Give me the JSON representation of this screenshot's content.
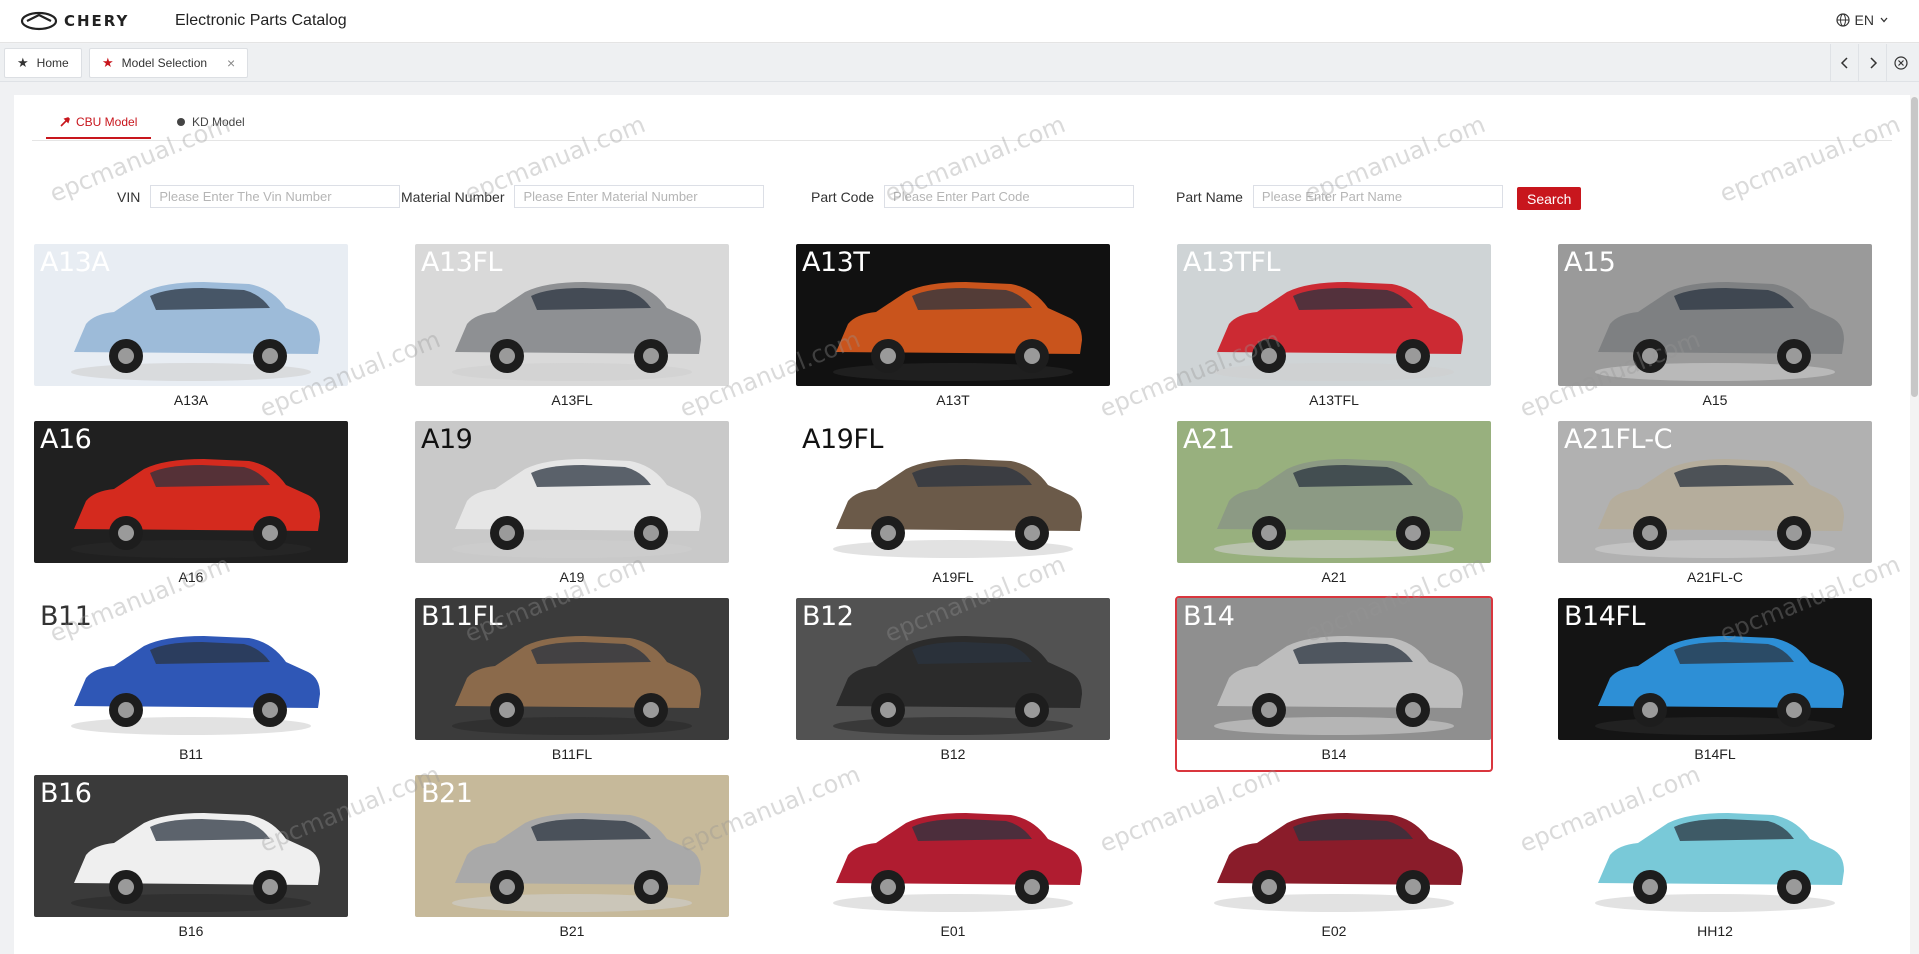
{
  "header": {
    "logo_text": "CHERY",
    "app_title": "Electronic Parts Catalog",
    "language": "EN"
  },
  "tabs": [
    {
      "label": "Home",
      "icon": "star-icon"
    },
    {
      "label": "Model Selection",
      "icon": "star-icon",
      "closable": true
    }
  ],
  "model_tabs": [
    {
      "label": "CBU Model",
      "active": true
    },
    {
      "label": "KD Model",
      "active": false
    }
  ],
  "search": {
    "vin_label": "VIN",
    "vin_placeholder": "Please Enter The Vin Number",
    "material_label": "Material Number",
    "material_placeholder": "Please Enter Material Number",
    "part_code_label": "Part Code",
    "part_code_placeholder": "Please Enter Part Code",
    "part_name_label": "Part Name",
    "part_name_placeholder": "Please Enter Part Name",
    "search_button": "Search"
  },
  "watermark_text": "epcmanual.com",
  "colors": {
    "accent": "#c8161d",
    "selected_border": "#d9363e"
  },
  "models": [
    {
      "code": "A13A",
      "overlay": "A13A",
      "bg": "#e8edf3",
      "car": "#9dbbd9",
      "overlay_color": "#ffffff",
      "dark": false
    },
    {
      "code": "A13FL",
      "overlay": "A13FL",
      "bg": "#d9d9d9",
      "car": "#8e9093",
      "overlay_color": "#ffffff",
      "dark": false
    },
    {
      "code": "A13T",
      "overlay": "A13T",
      "bg": "#111111",
      "car": "#c9541c",
      "overlay_color": "#ffffff",
      "dark": true
    },
    {
      "code": "A13TFL",
      "overlay": "A13TFL",
      "bg": "#cfd4d6",
      "car": "#cc2a33",
      "overlay_color": "#ffffff",
      "dark": false
    },
    {
      "code": "A15",
      "overlay": "A15",
      "bg": "#9a9a9a",
      "car": "#7e8082",
      "overlay_color": "#ffffff",
      "dark": false
    },
    {
      "code": "A16",
      "overlay": "A16",
      "bg": "#202020",
      "car": "#d42a1e",
      "overlay_color": "#ffffff",
      "dark": true
    },
    {
      "code": "A19",
      "overlay": "A19",
      "bg": "#c9c9c9",
      "car": "#e6e6e6",
      "overlay_color": "#111111",
      "dark": false
    },
    {
      "code": "A19FL",
      "overlay": "A19FL",
      "bg": "#ffffff",
      "car": "#6b5a49",
      "overlay_color": "#111111",
      "dark": false
    },
    {
      "code": "A21",
      "overlay": "A21",
      "bg": "#98b07e",
      "car": "#8c9a84",
      "overlay_color": "#ffffff",
      "dark": false
    },
    {
      "code": "A21FL-C",
      "overlay": "A21FL-C",
      "bg": "#b1b1b1",
      "car": "#b5ad9c",
      "overlay_color": "#ffffff",
      "dark": false
    },
    {
      "code": "B11",
      "overlay": "B11",
      "bg": "#ffffff",
      "car": "#2f57b6",
      "overlay_color": "#333333",
      "dark": false
    },
    {
      "code": "B11FL",
      "overlay": "B11FL",
      "bg": "#3b3b3b",
      "car": "#8b6a4b",
      "overlay_color": "#ffffff",
      "dark": true
    },
    {
      "code": "B12",
      "overlay": "B12",
      "bg": "#525252",
      "car": "#2b2b2b",
      "overlay_color": "#ffffff",
      "dark": true
    },
    {
      "code": "B14",
      "overlay": "B14",
      "bg": "#8f8f8f",
      "car": "#bdbdbd",
      "overlay_color": "#ffffff",
      "dark": false,
      "selected": true
    },
    {
      "code": "B14FL",
      "overlay": "B14FL",
      "bg": "#141414",
      "car": "#2d8fd6",
      "overlay_color": "#ffffff",
      "dark": true
    },
    {
      "code": "B16",
      "overlay": "B16",
      "bg": "#3a3a3a",
      "car": "#efefef",
      "overlay_color": "#ffffff",
      "dark": true
    },
    {
      "code": "B21",
      "overlay": "B21",
      "bg": "#c6b99a",
      "car": "#a9a9a9",
      "overlay_color": "#ffffff",
      "dark": false
    },
    {
      "code": "E01",
      "overlay": "",
      "bg": "#ffffff",
      "car": "#b01c30",
      "overlay_color": "#ffffff",
      "dark": false
    },
    {
      "code": "E02",
      "overlay": "",
      "bg": "#ffffff",
      "car": "#8a1c2a",
      "overlay_color": "#ffffff",
      "dark": false
    },
    {
      "code": "HH12",
      "overlay": "",
      "bg": "#ffffff",
      "car": "#79c9d8",
      "overlay_color": "#ffffff",
      "dark": false
    }
  ]
}
